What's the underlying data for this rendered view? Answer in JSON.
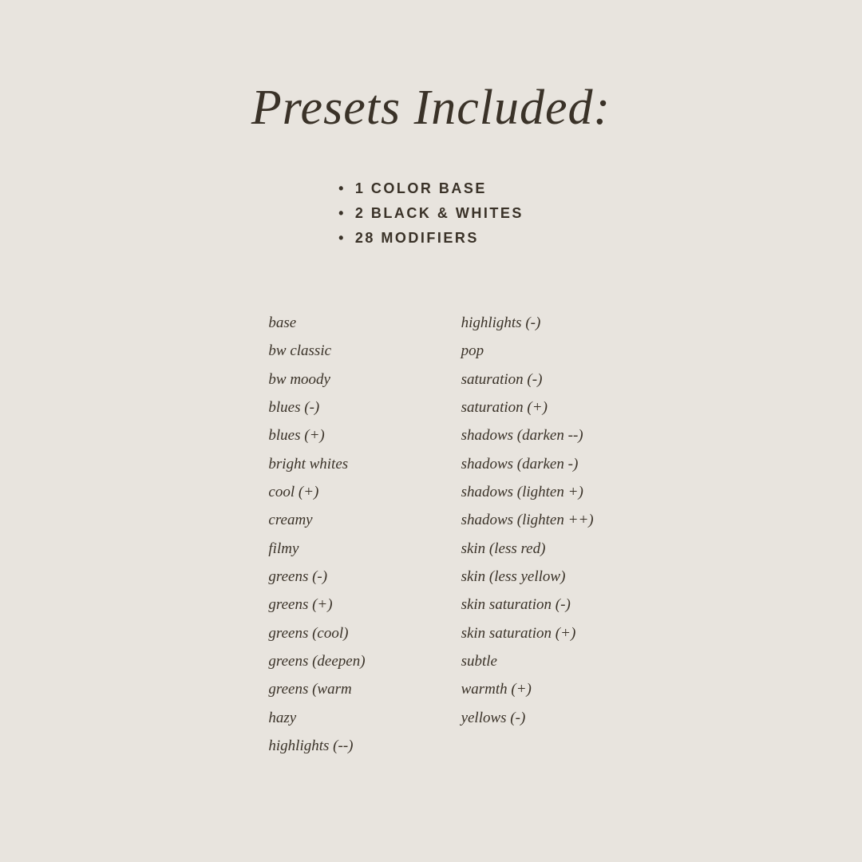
{
  "title": "Presets Included:",
  "bullets": [
    {
      "label": "1 COLOR BASE"
    },
    {
      "label": "2 BLACK & WHITES"
    },
    {
      "label": "28 MODIFIERS"
    }
  ],
  "column_left": [
    "base",
    "bw classic",
    "bw moody",
    "blues (-)",
    "blues (+)",
    "bright whites",
    "cool (+)",
    "creamy",
    "filmy",
    "greens (-)",
    "greens (+)",
    "greens (cool)",
    "greens (deepen)",
    "greens (warm",
    "hazy",
    "highlights (--)"
  ],
  "column_right": [
    "highlights (-)",
    "pop",
    "saturation (-)",
    "saturation (+)",
    "shadows (darken --)",
    "shadows (darken -)",
    "shadows (lighten +)",
    "shadows (lighten ++)",
    "skin (less red)",
    "skin (less yellow)",
    "skin saturation (-)",
    "skin saturation (+)",
    "subtle",
    "warmth (+)",
    "yellows (-)"
  ]
}
